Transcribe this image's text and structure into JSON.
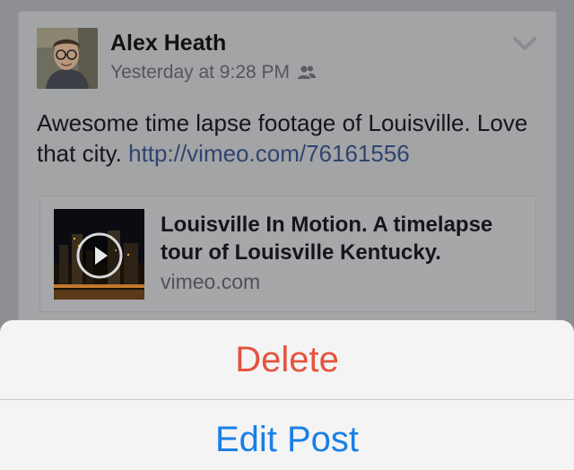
{
  "post": {
    "author": "Alex Heath",
    "timestamp": "Yesterday at 9:28 PM",
    "audience_icon": "friends-icon",
    "menu_icon": "chevron-down-icon",
    "text": "Awesome time lapse footage of Louisville. Love that city.",
    "link_text": "http://vimeo.com/76161556",
    "link_preview": {
      "title": "Louisville In Motion. A timelapse tour of Louisville Kentucky.",
      "domain": "vimeo.com",
      "play_icon": "play-icon"
    }
  },
  "action_sheet": {
    "delete_label": "Delete",
    "edit_label": "Edit Post"
  },
  "colors": {
    "delete": "#e5533e",
    "edit": "#1a7fe6",
    "link": "#2f4470"
  }
}
